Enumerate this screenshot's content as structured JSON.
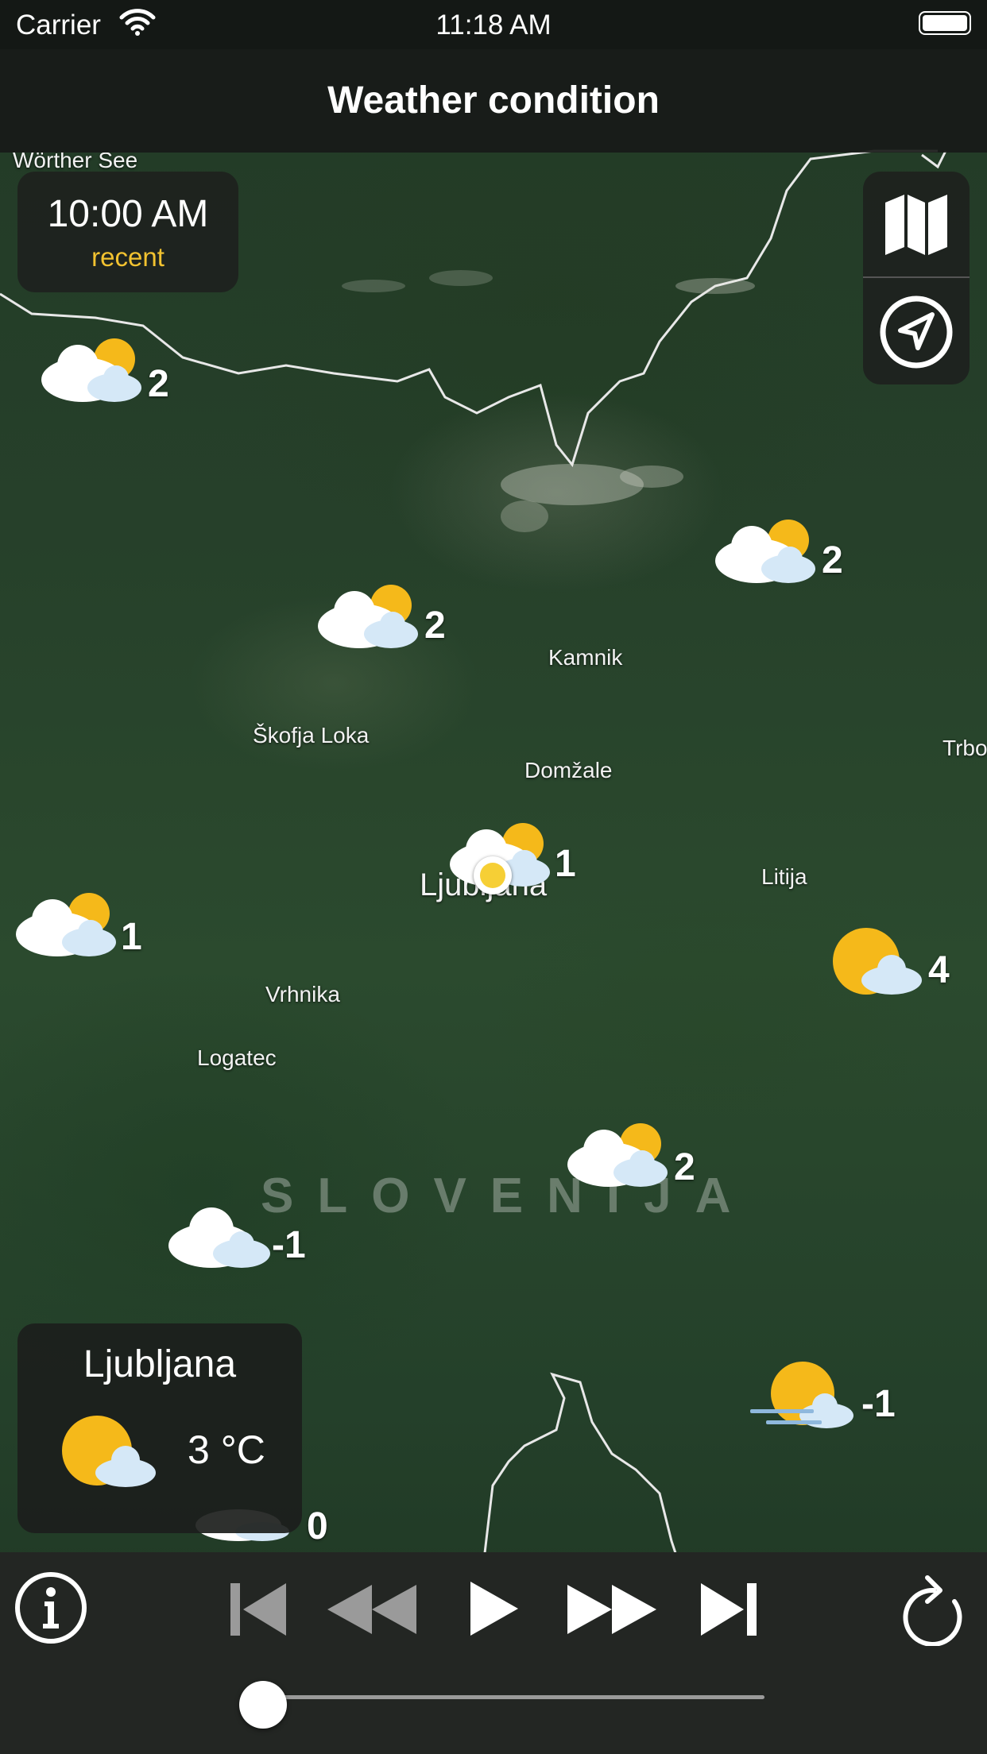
{
  "status_bar": {
    "carrier": "Carrier",
    "time": "11:18 AM"
  },
  "navbar": {
    "title": "Weather condition"
  },
  "time_card": {
    "time": "10:00 AM",
    "label": "recent"
  },
  "map": {
    "country": "SLOVENIJA",
    "places": [
      "Wörther See",
      "Kamnik",
      "Škofja Loka",
      "Domžale",
      "Ljubljana",
      "Litija",
      "Trbo",
      "Vrhnika",
      "Logatec"
    ]
  },
  "markers": [
    {
      "icon": "partly-cloudy-icon",
      "value": "2"
    },
    {
      "icon": "partly-cloudy-icon",
      "value": "2"
    },
    {
      "icon": "partly-cloudy-icon",
      "value": "2"
    },
    {
      "icon": "partly-cloudy-icon",
      "value": "1"
    },
    {
      "icon": "partly-cloudy-icon",
      "value": "1"
    },
    {
      "icon": "sun-cloud-icon",
      "value": "4"
    },
    {
      "icon": "partly-cloudy-icon",
      "value": "2"
    },
    {
      "icon": "cloud-icon",
      "value": "-1"
    },
    {
      "icon": "fog-sun-icon",
      "value": "-1"
    },
    {
      "icon": "cloud-icon",
      "value": "0"
    }
  ],
  "info_card": {
    "city": "Ljubljana",
    "temperature": "3 °C",
    "icon": "sun-cloud-icon"
  },
  "player": {
    "progress": 0.02,
    "buttons": [
      "info-icon",
      "skip-first-icon",
      "rewind-icon",
      "play-icon",
      "fast-forward-icon",
      "skip-last-icon",
      "refresh-icon"
    ]
  },
  "colors": {
    "accent": "#f2c230",
    "bar": "#232623"
  }
}
